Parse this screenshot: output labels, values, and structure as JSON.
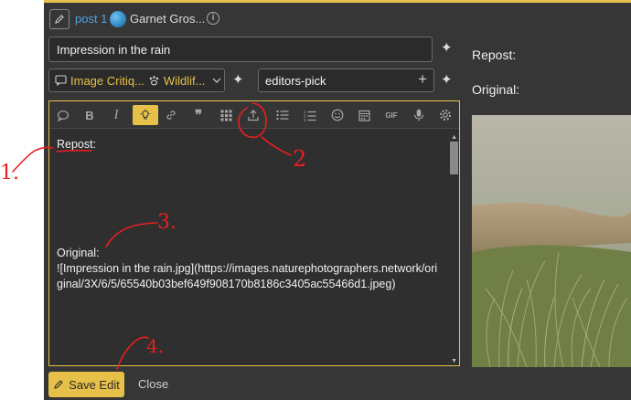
{
  "header": {
    "post_link": "post 1",
    "author": "Garnet Gros...",
    "info_symbol": "i"
  },
  "title_field": {
    "value": "Impression in the rain"
  },
  "category": {
    "first": "Image Critiq...",
    "second": "Wildlif..."
  },
  "tags": {
    "value": "editors-pick"
  },
  "toolbar": {
    "items": [
      "speech-bubble-icon",
      "bold-icon",
      "italic-icon",
      "lightbulb-icon",
      "link-icon",
      "quote-icon",
      "grid-icon",
      "upload-icon",
      "bullet-list-icon",
      "numbered-list-icon",
      "emoji-icon",
      "calendar-icon",
      "gif-icon",
      "microphone-icon",
      "gear-icon"
    ],
    "active": "lightbulb-icon",
    "gif_label": "GIF"
  },
  "editor": {
    "line_repost": "Repost:",
    "line_original": "Original:",
    "line_markdown": "![Impression in the rain.jpg](https://images.naturephotographers.network/original/3X/6/5/65540b03bef649f908170b8186c3405ac55466d1.jpeg)"
  },
  "preview": {
    "repost_label": "Repost:",
    "original_label": "Original:"
  },
  "footer": {
    "save_label": "Save Edit",
    "close_label": "Close"
  },
  "annotations": [
    "1.",
    "2",
    "3.",
    "4."
  ],
  "colors": {
    "accent": "#e6c048",
    "link": "#4fa3e0",
    "panel": "#363636",
    "annotation": "#e81f1f"
  }
}
